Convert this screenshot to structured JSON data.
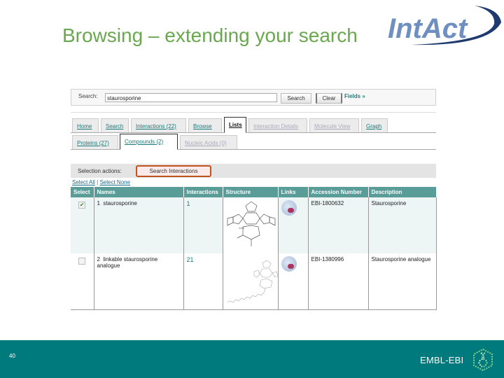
{
  "slide": {
    "title": "Browsing – extending your search",
    "page_number": "40",
    "footer_org": "EMBL-EBI",
    "logo_text": "IntAct",
    "title_color": "#6aa84f",
    "footer_color": "#007a7c"
  },
  "search": {
    "label": "Search:",
    "value": "staurosporine",
    "search_button": "Search",
    "clear_button": "Clear",
    "fields_link": "Fields »"
  },
  "tabs": [
    {
      "label": "Home",
      "state": "link"
    },
    {
      "label": "Search",
      "state": "link"
    },
    {
      "label": "Interactions (22)",
      "state": "link"
    },
    {
      "label": "Browse",
      "state": "link"
    },
    {
      "label": "Lists",
      "state": "active"
    },
    {
      "label": "Interaction Details",
      "state": "disabled"
    },
    {
      "label": "Molecule View",
      "state": "disabled"
    },
    {
      "label": "Graph",
      "state": "link"
    }
  ],
  "subtabs": [
    {
      "label": "Proteins (27)",
      "state": "link"
    },
    {
      "label": "Compounds (2)",
      "state": "active"
    },
    {
      "label": "Nucleic Acids (0)",
      "state": "disabled"
    }
  ],
  "selection": {
    "label": "Selection actions:",
    "button": "Search Interactions",
    "select_all": "Select All",
    "separator": "|",
    "select_none": "Select None"
  },
  "table": {
    "columns": [
      "Select",
      "Names",
      "Interactions",
      "Structure",
      "Links",
      "Accession Number",
      "Description"
    ],
    "rows": [
      {
        "checked": true,
        "index": "1",
        "name": "staurosporine",
        "interactions": "1",
        "links": "ChEBI",
        "accession": "EBI-1800632",
        "description": "Staurosporine"
      },
      {
        "checked": false,
        "index": "2",
        "name": "linkable staurosporine analogue",
        "interactions": "21",
        "links": "ChEBI",
        "accession": "EBI-1380996",
        "description": "Staurosporine analogue"
      }
    ]
  }
}
